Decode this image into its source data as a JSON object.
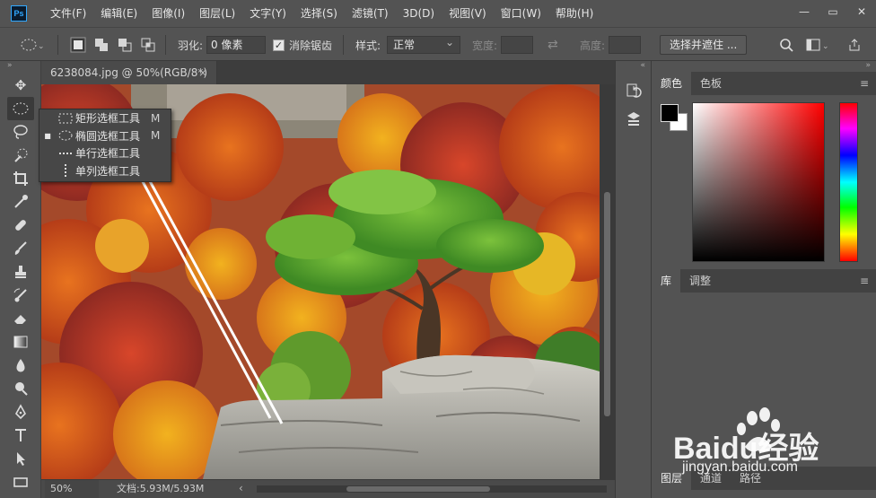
{
  "menubar": {
    "logo": "Ps",
    "items": [
      "文件(F)",
      "编辑(E)",
      "图像(I)",
      "图层(L)",
      "文字(Y)",
      "选择(S)",
      "滤镜(T)",
      "3D(D)",
      "视图(V)",
      "窗口(W)",
      "帮助(H)"
    ]
  },
  "options": {
    "feather_label": "羽化:",
    "feather_value": "0 像素",
    "antialias_label": "消除锯齿",
    "style_label": "样式:",
    "style_value": "正常",
    "width_label": "宽度:",
    "height_label": "高度:",
    "select_mask_button": "选择并遮住 ..."
  },
  "document": {
    "tab_title": "6238084.jpg @ 50%(RGB/8*)",
    "close": "×"
  },
  "flyout": {
    "items": [
      {
        "label": "矩形选框工具",
        "shortcut": "M"
      },
      {
        "label": "椭圆选框工具",
        "shortcut": "M",
        "selected": true
      },
      {
        "label": "单行选框工具",
        "shortcut": ""
      },
      {
        "label": "单列选框工具",
        "shortcut": ""
      }
    ]
  },
  "status": {
    "zoom": "50%",
    "doc_info": "文档:5.93M/5.93M"
  },
  "panels": {
    "color_tabs": [
      "颜色",
      "色板"
    ],
    "library_tabs": [
      "库",
      "调整"
    ],
    "layer_tabs": [
      "图层",
      "通道",
      "路径"
    ]
  },
  "colors": {
    "fg": "#000000",
    "bg": "#ffffff"
  },
  "watermark": {
    "brand": "Baidu经验",
    "url": "jingyan.baidu.com"
  }
}
